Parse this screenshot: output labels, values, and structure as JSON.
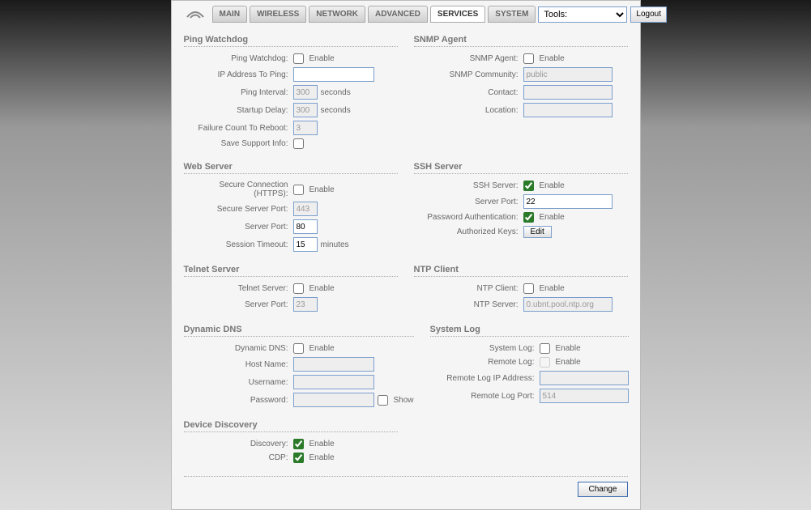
{
  "tabs": {
    "main": "MAIN",
    "wireless": "WIRELESS",
    "network": "NETWORK",
    "advanced": "ADVANCED",
    "services": "SERVICES",
    "system": "SYSTEM"
  },
  "tools": {
    "label": "Tools:"
  },
  "logout": "Logout",
  "ping_watchdog": {
    "title": "Ping Watchdog",
    "enable_label": "Ping Watchdog:",
    "enable_text": "Enable",
    "ip_label": "IP Address To Ping:",
    "ip_value": "",
    "interval_label": "Ping Interval:",
    "interval_value": "300",
    "interval_unit": "seconds",
    "startup_label": "Startup Delay:",
    "startup_value": "300",
    "startup_unit": "seconds",
    "failcount_label": "Failure Count To Reboot:",
    "failcount_value": "3",
    "save_label": "Save Support Info:"
  },
  "snmp": {
    "title": "SNMP Agent",
    "enable_label": "SNMP Agent:",
    "enable_text": "Enable",
    "community_label": "SNMP Community:",
    "community_value": "public",
    "contact_label": "Contact:",
    "contact_value": "",
    "location_label": "Location:",
    "location_value": ""
  },
  "webserver": {
    "title": "Web Server",
    "https_label": "Secure Connection (HTTPS):",
    "enable_text": "Enable",
    "secure_port_label": "Secure Server Port:",
    "secure_port_value": "443",
    "port_label": "Server Port:",
    "port_value": "80",
    "timeout_label": "Session Timeout:",
    "timeout_value": "15",
    "timeout_unit": "minutes"
  },
  "ssh": {
    "title": "SSH Server",
    "enable_label": "SSH Server:",
    "enable_text": "Enable",
    "port_label": "Server Port:",
    "port_value": "22",
    "pwauth_label": "Password Authentication:",
    "keys_label": "Authorized Keys:",
    "edit_btn": "Edit"
  },
  "telnet": {
    "title": "Telnet Server",
    "enable_label": "Telnet Server:",
    "enable_text": "Enable",
    "port_label": "Server Port:",
    "port_value": "23"
  },
  "ntp": {
    "title": "NTP Client",
    "enable_label": "NTP Client:",
    "enable_text": "Enable",
    "server_label": "NTP Server:",
    "server_value": "0.ubnt.pool.ntp.org"
  },
  "ddns": {
    "title": "Dynamic DNS",
    "enable_label": "Dynamic DNS:",
    "enable_text": "Enable",
    "host_label": "Host Name:",
    "host_value": "",
    "user_label": "Username:",
    "user_value": "",
    "pass_label": "Password:",
    "pass_value": "",
    "show_text": "Show"
  },
  "syslog": {
    "title": "System Log",
    "enable_label": "System Log:",
    "enable_text": "Enable",
    "remote_label": "Remote Log:",
    "ip_label": "Remote Log IP Address:",
    "ip_value": "",
    "port_label": "Remote Log Port:",
    "port_value": "514"
  },
  "discovery": {
    "title": "Device Discovery",
    "disc_label": "Discovery:",
    "enable_text": "Enable",
    "cdp_label": "CDP:"
  },
  "change_btn": "Change"
}
